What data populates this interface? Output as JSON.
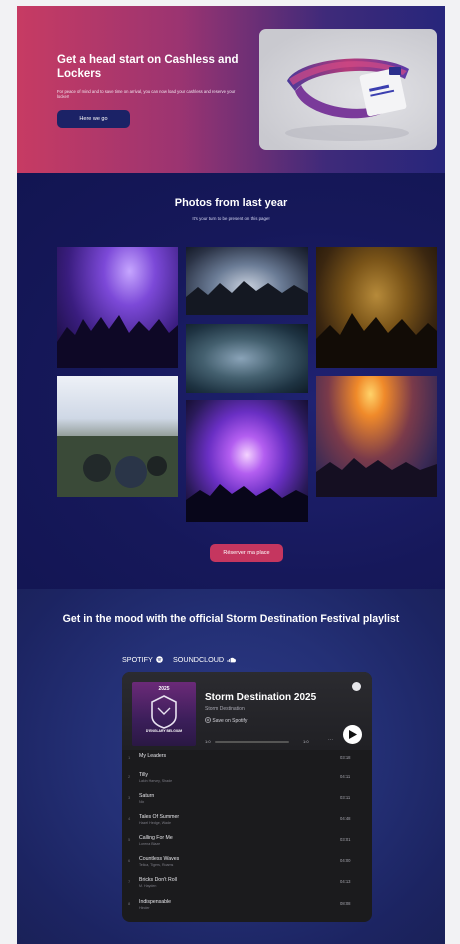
{
  "hero": {
    "title": "Get a head start on Cashless and Lockers",
    "subtitle": "For peace of mind and to save time on arrival, you can now load your cashless and reserve your locker!",
    "button": "Here we go"
  },
  "photos": {
    "title": "Photos from last year",
    "subtitle": "It's your turn to be present on this page!",
    "button": "Réserver ma place"
  },
  "playlist": {
    "title": "Get in the mood with the official Storm Destination Festival playlist",
    "tabs": [
      {
        "label": "SPOTIFY"
      },
      {
        "label": "SOUNDCLOUD"
      }
    ],
    "player": {
      "name": "Storm Destination 2025",
      "artist": "Storm Destination",
      "save": "Save on Spotify",
      "cover_year": "2025",
      "cover_caption": "D'ENGLARY BELGIUM",
      "prev": "1:0",
      "time": "1:0",
      "more": "···",
      "tracks": [
        {
          "n": "1",
          "title": "My Leaders",
          "artist": "",
          "dur": "03:18"
        },
        {
          "n": "2",
          "title": "Tilly",
          "artist": "Lakin Harvey, Shade",
          "dur": "04:11"
        },
        {
          "n": "3",
          "title": "Saturn",
          "artist": "Nix",
          "dur": "03:11"
        },
        {
          "n": "4",
          "title": "Tales Of Summer",
          "artist": "Hazel Hedge, Wade",
          "dur": "04:48"
        },
        {
          "n": "5",
          "title": "Calling For Me",
          "artist": "Lorena Blaze",
          "dur": "03:01"
        },
        {
          "n": "6",
          "title": "Countless Waves",
          "artist": "Telica, Tigers, Roams",
          "dur": "04:00"
        },
        {
          "n": "7",
          "title": "Bricks Don't Roll",
          "artist": "M. Hayden",
          "dur": "04:13"
        },
        {
          "n": "8",
          "title": "Indispensable",
          "artist": "Hinder",
          "dur": "08:08"
        }
      ]
    }
  },
  "colors": {
    "hero_button": "#1b2266",
    "cta_button": "#c5365f",
    "photos_bg": "#16185a",
    "playlist_bg": "#243076"
  }
}
